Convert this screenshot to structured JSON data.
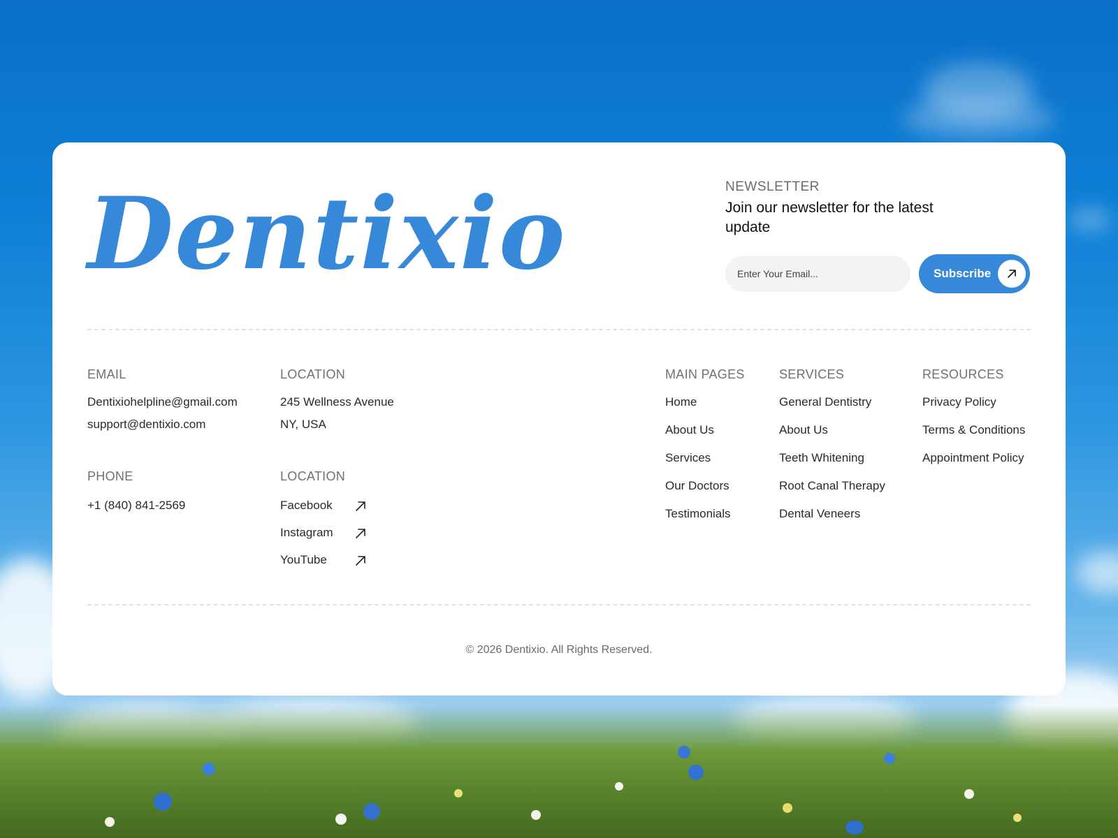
{
  "brand": {
    "logo_text": "Dentixio",
    "accent_color": "#3688d8"
  },
  "newsletter": {
    "label": "NEWSLETTER",
    "heading": "Join our newsletter for the latest update",
    "email_placeholder": "Enter Your Email...",
    "email_value": "",
    "subscribe_label": "Subscribe",
    "subscribe_icon": "arrow-up-right-icon"
  },
  "contact": {
    "email_heading": "EMAIL",
    "emails": [
      "Dentixiohelpline@gmail.com",
      "support@dentixio.com"
    ],
    "phone_heading": "PHONE",
    "phone": "+1 (840) 841-2569"
  },
  "location": {
    "heading": "LOCATION",
    "address_line1": "245 Wellness Avenue",
    "address_line2": "NY, USA"
  },
  "social": {
    "heading": "LOCATION",
    "items": [
      {
        "label": "Facebook",
        "icon": "arrow-up-right-icon"
      },
      {
        "label": "Instagram",
        "icon": "arrow-up-right-icon"
      },
      {
        "label": "YouTube",
        "icon": "arrow-up-right-icon"
      }
    ]
  },
  "main_pages": {
    "heading": "MAIN PAGES",
    "items": [
      "Home",
      "About Us",
      "Services",
      "Our Doctors",
      "Testimonials"
    ]
  },
  "services": {
    "heading": "SERVICES",
    "items": [
      "General Dentistry",
      "About Us",
      "Teeth Whitening",
      "Root Canal Therapy",
      "Dental Veneers"
    ]
  },
  "resources": {
    "heading": "RESOURCES",
    "items": [
      "Privacy Policy",
      "Terms & Conditions",
      "Appointment Policy"
    ]
  },
  "footer": {
    "copyright": "© 2026 Dentixio. All Rights Reserved."
  }
}
